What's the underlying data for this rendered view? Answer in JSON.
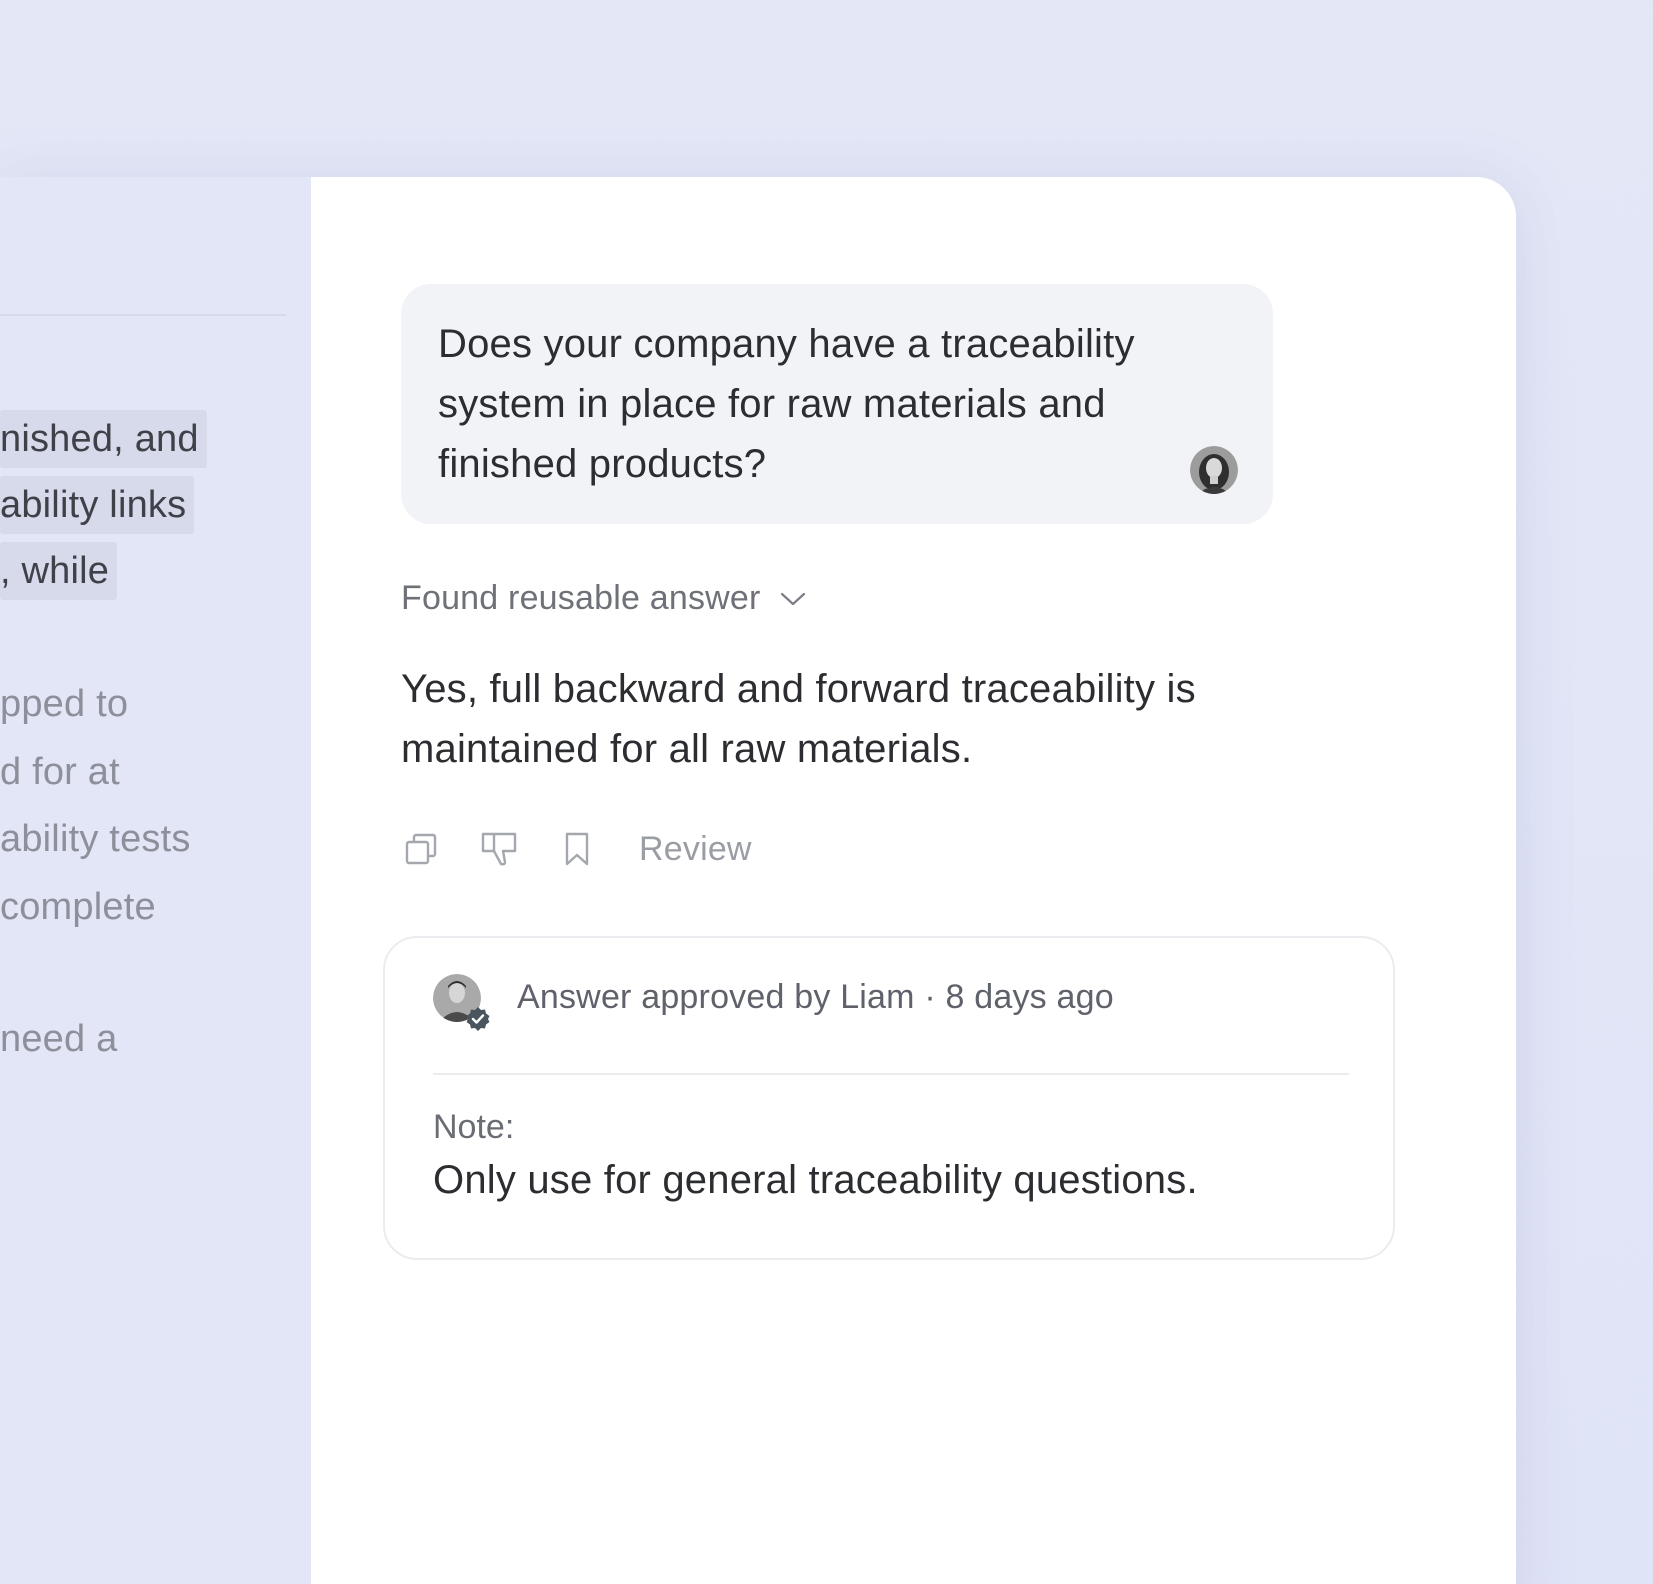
{
  "document": {
    "highlighted_lines": [
      "nished, and",
      "ability links",
      ", while"
    ],
    "dim_lines": [
      "pped to",
      "d for at",
      "ability tests",
      "complete",
      "need a"
    ]
  },
  "chat": {
    "question": "Does your company have a traceability system in place for raw materials and finished products?",
    "found_label": "Found reusable answer",
    "answer": "Yes, full backward and forward traceability is maintained for all raw materials.",
    "actions": {
      "icons": [
        "copy-icon",
        "thumbs-down-icon",
        "bookmark-icon"
      ],
      "review_label": "Review"
    },
    "approval": {
      "text": "Answer approved by Liam · 8 days ago",
      "note_label": "Note:",
      "note_text": "Only use for general traceability questions."
    }
  },
  "colors": {
    "background": "#e3e7f6",
    "doc_pane": "#e3e6f7",
    "highlight": "#d6daeb",
    "bubble": "#f2f3f6",
    "text_primary": "#2b2d31",
    "text_muted": "#6e7178",
    "verified_badge": "#4a5560"
  }
}
